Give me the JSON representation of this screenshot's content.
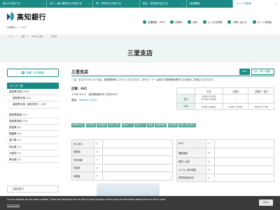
{
  "topbar": {
    "tabs": [
      "個人のお客さま",
      "法人・個人事業主のお客さま",
      "県・市町村のお客さま",
      "株主・投資家の皆さま",
      "採用情報",
      "サイト内検索"
    ]
  },
  "header": {
    "logo_text": "高知銀行",
    "bank_code": "金融機関コード：0578",
    "nav": [
      "店舗検索・ATM",
      "手数料",
      "金利",
      "よくある質問",
      "お問い合わせ",
      "サイト内検索"
    ]
  },
  "breadcrumb": [
    "ホーム",
    "〉",
    "店舗",
    "〉",
    "ATMのご案内",
    "〉",
    "三里支店"
  ],
  "page_title": "三里支店",
  "sidebar": {
    "search_label": "店舗・ATM検索",
    "area_title": "エリア一覧",
    "areas": [
      {
        "name": "高知県中部",
        "count": "(104)"
      },
      {
        "name": "高知県中部",
        "count": "(11)",
        "sub": true
      },
      {
        "name": "高知県中部（高知市外）",
        "count": "(45)",
        "sub": true
      },
      {
        "name": "高知県東部",
        "count": "(11)"
      },
      {
        "name": "高知県西部",
        "count": "(20)"
      },
      {
        "name": "徳島県",
        "count": "(6)"
      },
      {
        "name": "愛媛県",
        "count": "(9)"
      },
      {
        "name": "香川県",
        "count": "(1)"
      },
      {
        "name": "岡山県",
        "count": "(1)"
      },
      {
        "name": "大阪府",
        "count": "(1)"
      },
      {
        "name": "東京都",
        "count": "(1)"
      }
    ],
    "sub_section": "ご相談窓口"
  },
  "branch": {
    "name": "三里支店",
    "badges": [
      "ATM",
      "窓口（有人店舗）"
    ],
    "notice": "（注）平日11:30～12:30は、昼時間休業とさせていただきます。ATMコーナーは窓口の昼時間休業中も引き続きご利用いただけます。",
    "number": "店番：065",
    "address": "〒781-0112　高知県高知市仁井田1902",
    "tel_label": "電話：",
    "tel": "088-847-0341"
  },
  "hours": {
    "headers": [
      "",
      "平日",
      "土曜日",
      "日曜日・祝日"
    ],
    "rows": [
      {
        "label": "窓口",
        "weekday": "9:00～11:30\n12:30～15:00",
        "sat": "—",
        "sun": "—"
      },
      {
        "label": "ATM",
        "weekday": "8:45～18:00",
        "sat": "9:00～17:00",
        "sun": "9:00～17:00"
      }
    ]
  },
  "tags": [
    "駐車場(平日)",
    "公的年金",
    "資産運用",
    "NISA・投信",
    "個人ローン",
    "住宅ローン",
    "保険",
    "事業性融資",
    "外貨両替",
    "相続・遺言手続き"
  ],
  "services_left": [
    {
      "k": "有人窓口",
      "v": "○"
    },
    {
      "k": "駐車場",
      "v": "○"
    },
    {
      "k": "外貨両替",
      "v": "—"
    },
    {
      "k": "貸金庫",
      "v": "○"
    },
    {
      "k": "両替機",
      "v": "○"
    }
  ],
  "services_right": [
    {
      "k": "ATM",
      "v": "○"
    },
    {
      "k": "通帳繰越",
      "v": "○"
    },
    {
      "k": "硬貨入出金",
      "v": "○"
    },
    {
      "k": "ゆうちょ等の提携",
      "v": "○"
    },
    {
      "k": "視覚障害者対応",
      "v": "○"
    }
  ],
  "cookie": {
    "message": "On our website we use some cookies. These are necessary for our site to work properly and to give us information about how our site is used.",
    "link": "Learn more",
    "button": "Okay"
  }
}
